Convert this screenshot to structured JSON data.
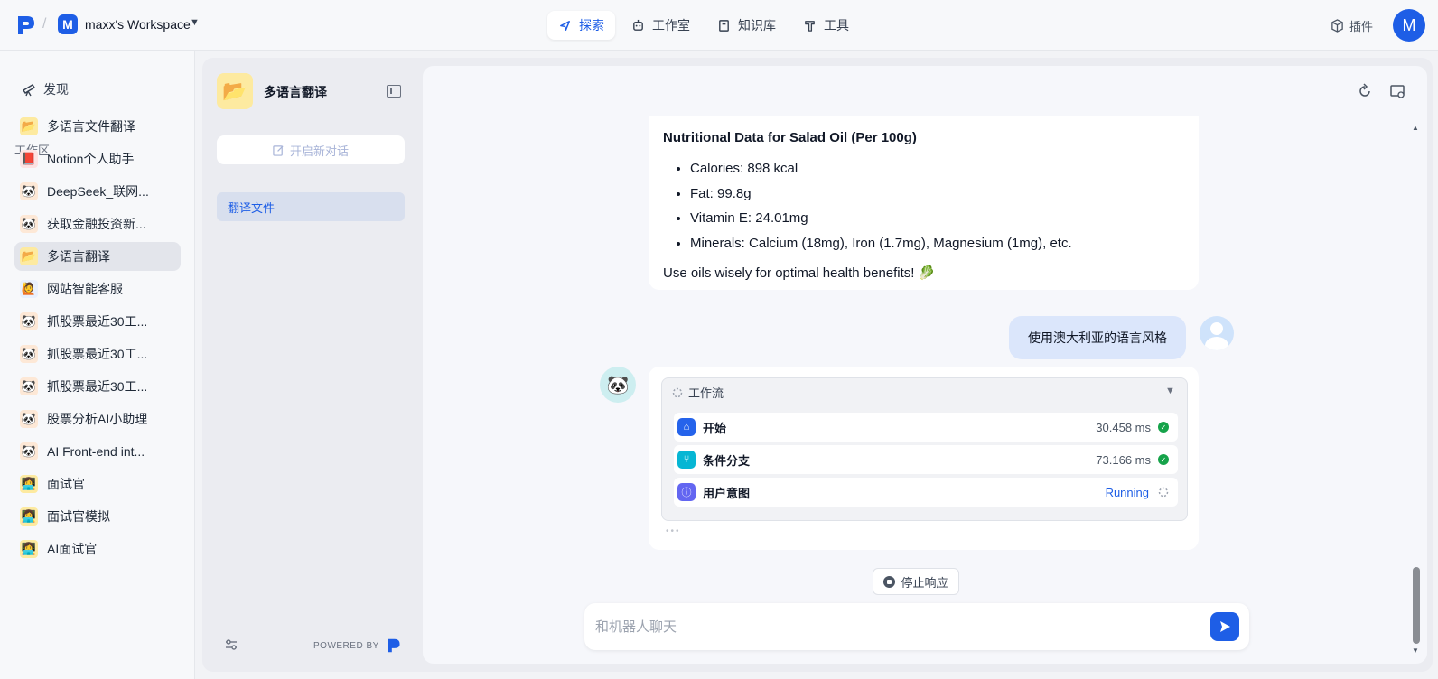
{
  "header": {
    "workspace_initial": "M",
    "workspace_name": "maxx's Workspace",
    "nav": [
      {
        "label": "探索",
        "icon": "compass-icon",
        "active": true
      },
      {
        "label": "工作室",
        "icon": "robot-icon",
        "active": false
      },
      {
        "label": "知识库",
        "icon": "book-icon",
        "active": false
      },
      {
        "label": "工具",
        "icon": "hammer-icon",
        "active": false
      }
    ],
    "plugin_label": "插件",
    "user_initial": "M"
  },
  "sidebar": {
    "discover_label": "发现",
    "section_label": "工作区",
    "items": [
      {
        "label": "多语言文件翻译",
        "icon": "📂",
        "bg": "#fdeaa0",
        "selected": false
      },
      {
        "label": "Notion个人助手",
        "icon": "📕",
        "bg": "#fde2e2",
        "selected": false
      },
      {
        "label": "DeepSeek_联网...",
        "icon": "🐼",
        "bg": "#fde8d6",
        "selected": false
      },
      {
        "label": "获取金融投资新...",
        "icon": "🐼",
        "bg": "#fde8d6",
        "selected": false
      },
      {
        "label": "多语言翻译",
        "icon": "📂",
        "bg": "#fdeaa0",
        "selected": true
      },
      {
        "label": "网站智能客服",
        "icon": "🙋",
        "bg": "#e8f0fe",
        "selected": false
      },
      {
        "label": "抓股票最近30工...",
        "icon": "🐼",
        "bg": "#fde8d6",
        "selected": false
      },
      {
        "label": "抓股票最近30工...",
        "icon": "🐼",
        "bg": "#fde8d6",
        "selected": false
      },
      {
        "label": "抓股票最近30工...",
        "icon": "🐼",
        "bg": "#fde8d6",
        "selected": false
      },
      {
        "label": "股票分析AI小助理",
        "icon": "🐼",
        "bg": "#fde8d6",
        "selected": false
      },
      {
        "label": "AI Front-end int...",
        "icon": "🐼",
        "bg": "#fde8d6",
        "selected": false
      },
      {
        "label": "面试官",
        "icon": "👩‍💻",
        "bg": "#fdeaa0",
        "selected": false
      },
      {
        "label": "面试官模拟",
        "icon": "👩‍💻",
        "bg": "#fdeaa0",
        "selected": false
      },
      {
        "label": "AI面试官",
        "icon": "👩‍💻",
        "bg": "#fdeaa0",
        "selected": false
      }
    ]
  },
  "panel": {
    "bot_name": "多语言翻译",
    "new_chat_label": "开启新对话",
    "conversation": "翻译文件",
    "powered_by": "POWERED BY"
  },
  "chat": {
    "message": {
      "title": "Nutritional Data for Salad Oil (Per 100g)",
      "items": [
        "Calories: 898 kcal",
        "Fat: 99.8g",
        "Vitamin E: 24.01mg",
        "Minerals: Calcium (18mg), Iron (1.7mg), Magnesium (1mg), etc."
      ],
      "footer": "Use oils wisely for optimal health benefits! 🥬"
    },
    "user_message": "使用澳大利亚的语言风格",
    "workflow": {
      "label": "工作流",
      "nodes": [
        {
          "name": "开始",
          "time": "30.458 ms",
          "status": "done",
          "color": "#2563eb",
          "glyph": "⌂"
        },
        {
          "name": "条件分支",
          "time": "73.166 ms",
          "status": "done",
          "color": "#06b6d4",
          "glyph": "⑂"
        },
        {
          "name": "用户意图",
          "time": "",
          "status": "Running",
          "color": "#6366f1",
          "glyph": "ⓘ"
        }
      ]
    },
    "stop_label": "停止响应",
    "input_placeholder": "和机器人聊天"
  },
  "colors": {
    "accent": "#1e5ee6",
    "success": "#16a34a"
  }
}
